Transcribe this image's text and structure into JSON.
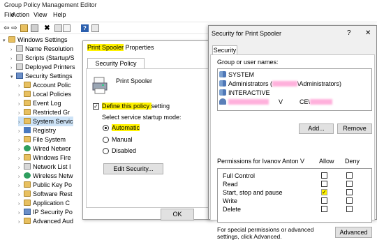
{
  "editor": {
    "title": "Group Policy Management Editor",
    "menu": [
      "File",
      "Action",
      "View",
      "Help"
    ],
    "tree": [
      {
        "label": "Windows Settings",
        "icon": "folder",
        "indent": 0
      },
      {
        "label": "Name Resolution",
        "icon": "doc",
        "indent": 1
      },
      {
        "label": "Scripts (Startup/S",
        "icon": "doc",
        "indent": 1
      },
      {
        "label": "Deployed Printers",
        "icon": "doc",
        "indent": 1
      },
      {
        "label": "Security Settings",
        "icon": "sec",
        "indent": 1
      },
      {
        "label": "Account Polic",
        "icon": "folder",
        "indent": 2
      },
      {
        "label": "Local Policies",
        "icon": "folder",
        "indent": 2
      },
      {
        "label": "Event Log",
        "icon": "folder",
        "indent": 2
      },
      {
        "label": "Restricted Gr",
        "icon": "folder",
        "indent": 2
      },
      {
        "label": "System Servic",
        "icon": "folder",
        "indent": 2
      },
      {
        "label": "Registry",
        "icon": "reg",
        "indent": 2
      },
      {
        "label": "File System",
        "icon": "folder",
        "indent": 2
      },
      {
        "label": "Wired Networ",
        "icon": "net",
        "indent": 2
      },
      {
        "label": "Windows Fire",
        "icon": "folder",
        "indent": 2
      },
      {
        "label": "Network List I",
        "icon": "doc",
        "indent": 2
      },
      {
        "label": "Wireless Netw",
        "icon": "net",
        "indent": 2
      },
      {
        "label": "Public Key Po",
        "icon": "folder",
        "indent": 2
      },
      {
        "label": "Software Rest",
        "icon": "folder",
        "indent": 2
      },
      {
        "label": "Application C",
        "icon": "folder",
        "indent": 2
      },
      {
        "label": "IP Security Po",
        "icon": "sec",
        "indent": 2
      },
      {
        "label": "Advanced Aud",
        "icon": "folder",
        "indent": 2
      }
    ]
  },
  "props": {
    "title_highlight": "Print Spooler",
    "title_rest": " Properties",
    "tab": "Security Policy Setting",
    "service_name": "Print Spooler",
    "define_prefix": "Define this policy ",
    "define_highlight": "setting",
    "startup_label": "Select service startup mode:",
    "modes": [
      "Automatic",
      "Manual",
      "Disabled"
    ],
    "edit_security": "Edit Security...",
    "ok": "OK"
  },
  "security": {
    "title": "Security for Print Spooler",
    "help": "?",
    "close": "✕",
    "tab": "Security",
    "group_label": "Group or user names:",
    "users": [
      {
        "label": "SYSTEM",
        "icon": "grp"
      },
      {
        "label": "Administrators (",
        "suffix": "\\Administrators)",
        "icon": "grp"
      },
      {
        "label": "INTERACTIVE",
        "icon": "grp"
      },
      {
        "label": "V",
        "suffix": "CE\\",
        "icon": "usr"
      }
    ],
    "add": "Add...",
    "remove": "Remove",
    "perm_header": "Permissions for Ivanov Anton V",
    "allow": "Allow",
    "deny": "Deny",
    "permissions": [
      {
        "name": "Full Control",
        "allow": false,
        "deny": false
      },
      {
        "name": "Read",
        "allow": false,
        "deny": false
      },
      {
        "name": "Start, stop and pause",
        "allow": true,
        "deny": false
      },
      {
        "name": "Write",
        "allow": false,
        "deny": false
      },
      {
        "name": "Delete",
        "allow": false,
        "deny": false
      }
    ],
    "special_text": "For special permissions or advanced settings, click Advanced.",
    "advanced": "Advanced",
    "highlight_color": "#fff200"
  }
}
